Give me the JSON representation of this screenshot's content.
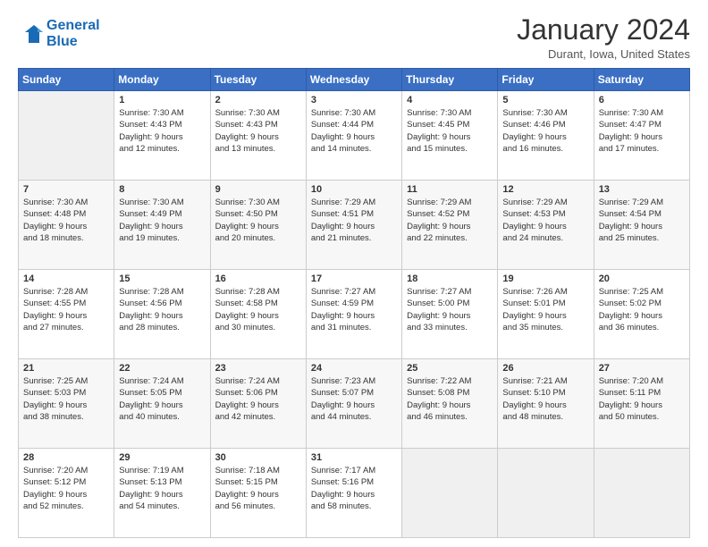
{
  "header": {
    "logo_line1": "General",
    "logo_line2": "Blue",
    "month": "January 2024",
    "location": "Durant, Iowa, United States"
  },
  "days_of_week": [
    "Sunday",
    "Monday",
    "Tuesday",
    "Wednesday",
    "Thursday",
    "Friday",
    "Saturday"
  ],
  "weeks": [
    [
      {
        "day": "",
        "info": ""
      },
      {
        "day": "1",
        "info": "Sunrise: 7:30 AM\nSunset: 4:43 PM\nDaylight: 9 hours\nand 12 minutes."
      },
      {
        "day": "2",
        "info": "Sunrise: 7:30 AM\nSunset: 4:43 PM\nDaylight: 9 hours\nand 13 minutes."
      },
      {
        "day": "3",
        "info": "Sunrise: 7:30 AM\nSunset: 4:44 PM\nDaylight: 9 hours\nand 14 minutes."
      },
      {
        "day": "4",
        "info": "Sunrise: 7:30 AM\nSunset: 4:45 PM\nDaylight: 9 hours\nand 15 minutes."
      },
      {
        "day": "5",
        "info": "Sunrise: 7:30 AM\nSunset: 4:46 PM\nDaylight: 9 hours\nand 16 minutes."
      },
      {
        "day": "6",
        "info": "Sunrise: 7:30 AM\nSunset: 4:47 PM\nDaylight: 9 hours\nand 17 minutes."
      }
    ],
    [
      {
        "day": "7",
        "info": "Sunrise: 7:30 AM\nSunset: 4:48 PM\nDaylight: 9 hours\nand 18 minutes."
      },
      {
        "day": "8",
        "info": "Sunrise: 7:30 AM\nSunset: 4:49 PM\nDaylight: 9 hours\nand 19 minutes."
      },
      {
        "day": "9",
        "info": "Sunrise: 7:30 AM\nSunset: 4:50 PM\nDaylight: 9 hours\nand 20 minutes."
      },
      {
        "day": "10",
        "info": "Sunrise: 7:29 AM\nSunset: 4:51 PM\nDaylight: 9 hours\nand 21 minutes."
      },
      {
        "day": "11",
        "info": "Sunrise: 7:29 AM\nSunset: 4:52 PM\nDaylight: 9 hours\nand 22 minutes."
      },
      {
        "day": "12",
        "info": "Sunrise: 7:29 AM\nSunset: 4:53 PM\nDaylight: 9 hours\nand 24 minutes."
      },
      {
        "day": "13",
        "info": "Sunrise: 7:29 AM\nSunset: 4:54 PM\nDaylight: 9 hours\nand 25 minutes."
      }
    ],
    [
      {
        "day": "14",
        "info": "Sunrise: 7:28 AM\nSunset: 4:55 PM\nDaylight: 9 hours\nand 27 minutes."
      },
      {
        "day": "15",
        "info": "Sunrise: 7:28 AM\nSunset: 4:56 PM\nDaylight: 9 hours\nand 28 minutes."
      },
      {
        "day": "16",
        "info": "Sunrise: 7:28 AM\nSunset: 4:58 PM\nDaylight: 9 hours\nand 30 minutes."
      },
      {
        "day": "17",
        "info": "Sunrise: 7:27 AM\nSunset: 4:59 PM\nDaylight: 9 hours\nand 31 minutes."
      },
      {
        "day": "18",
        "info": "Sunrise: 7:27 AM\nSunset: 5:00 PM\nDaylight: 9 hours\nand 33 minutes."
      },
      {
        "day": "19",
        "info": "Sunrise: 7:26 AM\nSunset: 5:01 PM\nDaylight: 9 hours\nand 35 minutes."
      },
      {
        "day": "20",
        "info": "Sunrise: 7:25 AM\nSunset: 5:02 PM\nDaylight: 9 hours\nand 36 minutes."
      }
    ],
    [
      {
        "day": "21",
        "info": "Sunrise: 7:25 AM\nSunset: 5:03 PM\nDaylight: 9 hours\nand 38 minutes."
      },
      {
        "day": "22",
        "info": "Sunrise: 7:24 AM\nSunset: 5:05 PM\nDaylight: 9 hours\nand 40 minutes."
      },
      {
        "day": "23",
        "info": "Sunrise: 7:24 AM\nSunset: 5:06 PM\nDaylight: 9 hours\nand 42 minutes."
      },
      {
        "day": "24",
        "info": "Sunrise: 7:23 AM\nSunset: 5:07 PM\nDaylight: 9 hours\nand 44 minutes."
      },
      {
        "day": "25",
        "info": "Sunrise: 7:22 AM\nSunset: 5:08 PM\nDaylight: 9 hours\nand 46 minutes."
      },
      {
        "day": "26",
        "info": "Sunrise: 7:21 AM\nSunset: 5:10 PM\nDaylight: 9 hours\nand 48 minutes."
      },
      {
        "day": "27",
        "info": "Sunrise: 7:20 AM\nSunset: 5:11 PM\nDaylight: 9 hours\nand 50 minutes."
      }
    ],
    [
      {
        "day": "28",
        "info": "Sunrise: 7:20 AM\nSunset: 5:12 PM\nDaylight: 9 hours\nand 52 minutes."
      },
      {
        "day": "29",
        "info": "Sunrise: 7:19 AM\nSunset: 5:13 PM\nDaylight: 9 hours\nand 54 minutes."
      },
      {
        "day": "30",
        "info": "Sunrise: 7:18 AM\nSunset: 5:15 PM\nDaylight: 9 hours\nand 56 minutes."
      },
      {
        "day": "31",
        "info": "Sunrise: 7:17 AM\nSunset: 5:16 PM\nDaylight: 9 hours\nand 58 minutes."
      },
      {
        "day": "",
        "info": ""
      },
      {
        "day": "",
        "info": ""
      },
      {
        "day": "",
        "info": ""
      }
    ]
  ]
}
